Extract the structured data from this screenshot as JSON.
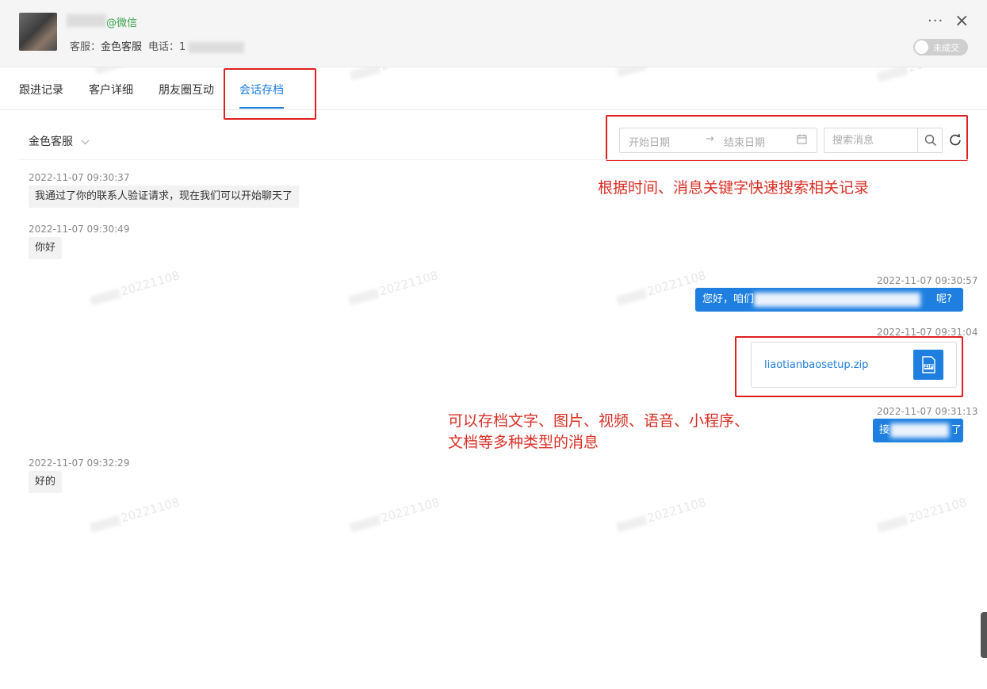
{
  "header": {
    "contact_source": "@微信",
    "agent_label": "客服：",
    "agent_name": "金色客服",
    "phone_label": "电话：",
    "phone_prefix": "1",
    "more_glyph": "···",
    "close_glyph": "×",
    "deal_status": "未成交"
  },
  "tabs": [
    {
      "label": "跟进记录"
    },
    {
      "label": "客户详细"
    },
    {
      "label": "朋友圈互动"
    },
    {
      "label": "会话存档"
    }
  ],
  "filter": {
    "agent_select": "金色客服",
    "start_placeholder": "开始日期",
    "end_placeholder": "结束日期",
    "range_arrow": "→",
    "search_placeholder": "搜索消息"
  },
  "notes": {
    "search_note": "根据时间、消息关键字快速搜索相关记录",
    "archive_note_line1": "可以存档文字、图片、视频、语音、小程序、",
    "archive_note_line2": "文档等多种类型的消息"
  },
  "messages": [
    {
      "side": "left",
      "time": "2022-11-07 09:30:37",
      "text": "我通过了你的联系人验证请求，现在我们可以开始聊天了"
    },
    {
      "side": "left",
      "time": "2022-11-07 09:30:49",
      "text": "你好"
    },
    {
      "side": "right",
      "time": "2022-11-07 09:30:57",
      "text_start": "您好，咱们",
      "text_end": "呢?"
    },
    {
      "side": "right",
      "time": "2022-11-07 09:31:04",
      "file_name": "liaotianbaosetup.zip",
      "file_badge": "ZIP"
    },
    {
      "side": "right",
      "time": "2022-11-07 09:31:13",
      "text_start": "接",
      "text_end": "了"
    },
    {
      "side": "left",
      "time": "2022-11-07 09:32:29",
      "text": "好的"
    }
  ],
  "watermark": "20221108",
  "colors": {
    "accent": "#1f7ee0",
    "annotation_red": "#e02020",
    "wechat_green": "#3aa34b",
    "bubble_in": "#f2f2f2",
    "bubble_out": "#1e7fe0"
  }
}
